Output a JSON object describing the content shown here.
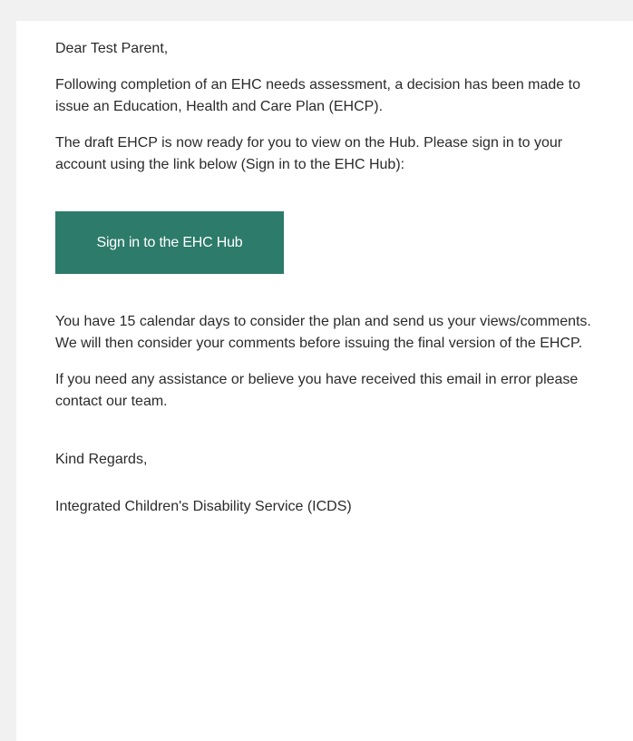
{
  "email": {
    "greeting": "Dear Test Parent,",
    "decision_text": "Following completion of an EHC needs assessment, a decision has been made to issue an Education, Health and Care Plan (EHCP).",
    "draft_text": "The draft EHCP is now ready for you to view on the Hub. Please sign in to your account using the link below (Sign in to the EHC Hub):",
    "cta_label": "Sign in to the EHC Hub",
    "cta_color": "#2d7b6a",
    "days_text": "You have 15 calendar days to consider the plan and send us your views/comments. We will then consider your comments before issuing the final version of the EHCP.",
    "help_text": "If you need any assistance or believe you have received this email in error please contact our team.",
    "signoff": "Kind Regards,",
    "signature": "Integrated Children's Disability Service (ICDS)"
  }
}
